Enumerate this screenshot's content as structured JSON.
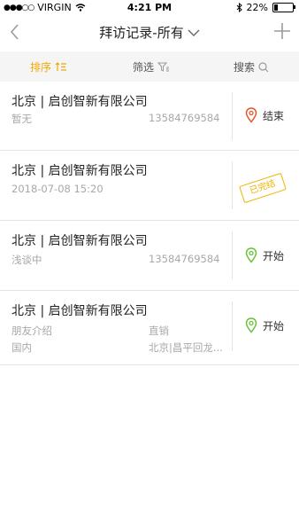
{
  "status_bar": {
    "carrier": "VIRGIN",
    "time": "4:21 PM",
    "battery": "22%",
    "battery_level": 0.22
  },
  "nav": {
    "title": "拜访记录-所有",
    "back_icon": "chevron-left-icon",
    "dropdown_icon": "chevron-down-icon",
    "add_icon": "plus-icon"
  },
  "filter_bar": {
    "sort_label": "排序",
    "filter_label": "筛选",
    "search_label": "搜索",
    "accent": "#f2a900"
  },
  "records": [
    {
      "company": "北京 | 启创智新有限公司",
      "left": "暂无",
      "right": "13584769584",
      "action": "结束",
      "action_icon": "location-pin-icon",
      "pin_color": "#e2582d"
    },
    {
      "company": "北京 | 启创智新有限公司",
      "left": "2018-07-08 15:20",
      "stamp": "已完结"
    },
    {
      "company": "北京 | 启创智新有限公司",
      "left": "浅谈中",
      "right": "13584769584",
      "action": "开始",
      "action_icon": "location-pin-icon",
      "pin_color": "#6ac23c"
    },
    {
      "company": "北京 | 启创智新有限公司",
      "left": "朋友介绍",
      "left2": "国内",
      "right": "直销",
      "right2": "北京|昌平回龙...",
      "action": "开始",
      "action_icon": "location-pin-icon",
      "pin_color": "#6ac23c"
    }
  ]
}
